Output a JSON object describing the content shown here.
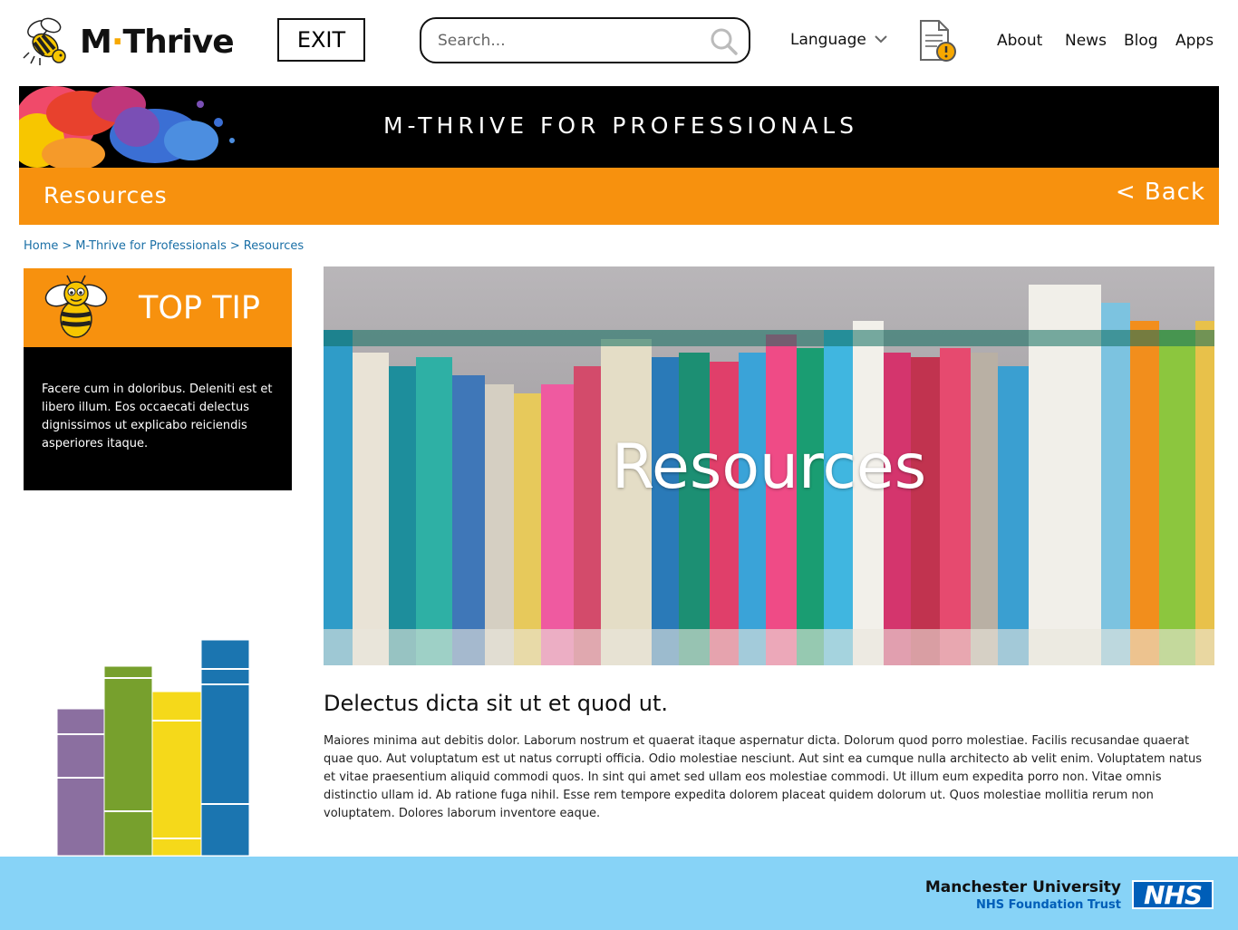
{
  "header": {
    "logo_text_left": "M",
    "logo_dot": "·",
    "logo_text_right": "Thrive",
    "exit_label": "EXIT",
    "search_placeholder": "Search...",
    "language_label": "Language",
    "nav": [
      "About",
      "News",
      "Blog",
      "Apps"
    ]
  },
  "banner": {
    "title": "M-THRIVE FOR PROFESSIONALS"
  },
  "subbar": {
    "title": "Resources",
    "back_label": "< Back"
  },
  "breadcrumb": [
    "Home",
    "M-Thrive for Professionals",
    "Resources"
  ],
  "breadcrumb_separator": ">",
  "top_tip": {
    "title": "TOP TIP",
    "text": "Facere cum in doloribus. Deleniti est et libero illum. Eos occaecati delectus dignissimos ut explicabo reiciendis asperiores itaque."
  },
  "hero": {
    "title": "Resources"
  },
  "content": {
    "heading": "Delectus dicta sit ut et quod ut.",
    "paragraph": "Maiores minima aut debitis dolor. Laborum nostrum et quaerat itaque aspernatur dicta. Dolorum quod porro molestiae. Facilis recusandae quaerat quae quo. Aut voluptatum est ut natus corrupti officia. Odio molestiae nesciunt. Aut sint ea cumque nulla architecto ab velit enim. Voluptatem natus et vitae praesentium aliquid commodi quos. In sint qui amet sed ullam eos molestiae commodi. Ut illum eum expedita porro non. Vitae omnis distinctio ullam id. Ab ratione fuga nihil. Esse rem tempore expedita dolorem placeat quidem dolorum ut. Quos molestiae mollitia rerum non voluptatem. Dolores laborum inventore eaque."
  },
  "footer": {
    "org_name": "Manchester University",
    "org_sub": "NHS Foundation Trust",
    "nhs_logo": "NHS"
  },
  "colors": {
    "accent_orange": "#f7910e",
    "footer_blue": "#87d3f7",
    "link_blue": "#1a6fa6",
    "nhs_blue": "#005eb8"
  },
  "icons": [
    "bee-logo-icon",
    "search-icon",
    "chevron-down-icon",
    "document-alert-icon",
    "bee-mascot-icon",
    "books-illustration"
  ]
}
